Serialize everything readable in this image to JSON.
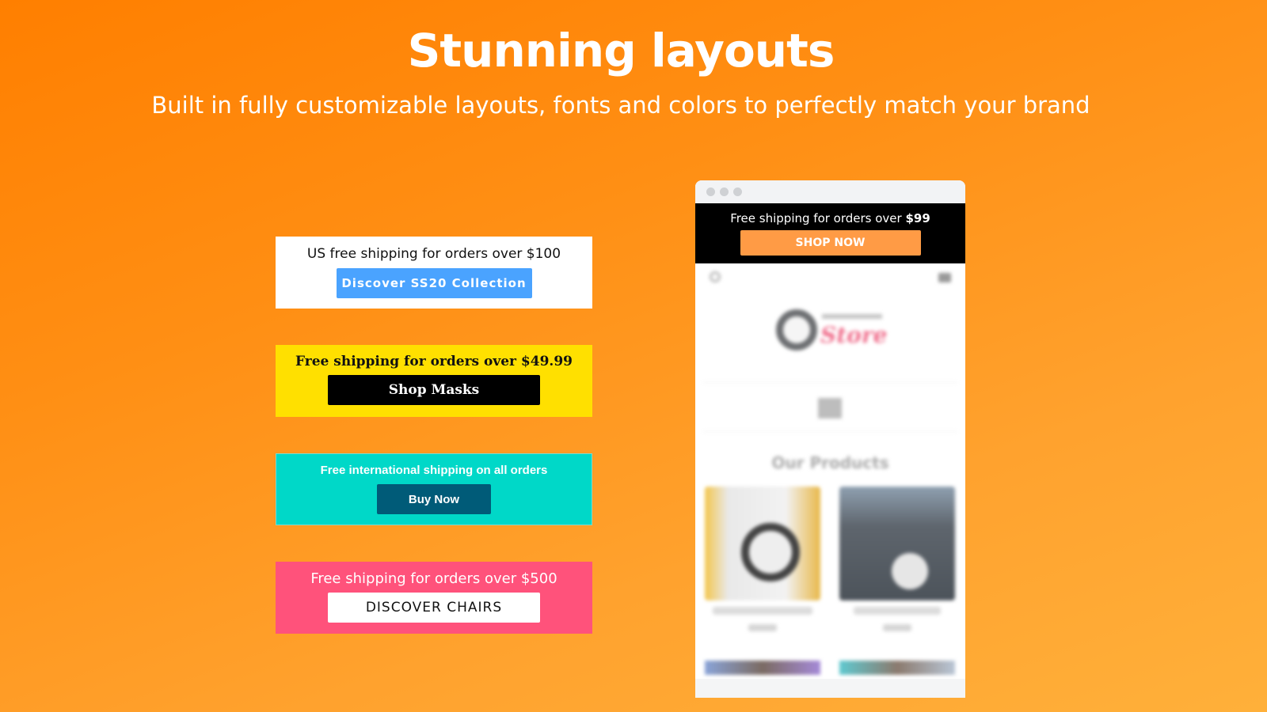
{
  "hero": {
    "title": "Stunning layouts",
    "subtitle": "Built in fully customizable layouts, fonts and colors to perfectly match your brand"
  },
  "banners": [
    {
      "message": "US free shipping for orders over $100",
      "button_label": "Discover SS20 Collection",
      "background": "#ffffff",
      "button_color": "#4aa3ff"
    },
    {
      "message": "Free shipping for orders over $49.99",
      "button_label": "Shop Masks",
      "background": "#ffe000",
      "button_color": "#000000"
    },
    {
      "message": "Free international shipping on all orders",
      "button_label": "Buy Now",
      "background": "#00d8c8",
      "button_color": "#005b78"
    },
    {
      "message": "Free shipping for orders over $500",
      "button_label": "DISCOVER CHAIRS",
      "background": "#ff527b",
      "button_color": "#ffffff"
    }
  ],
  "mockup": {
    "announcement_text": "Free shipping for orders over ",
    "announcement_amount": "$99",
    "button_label": "SHOP NOW",
    "background": "#000000",
    "button_color": "#ff9b45",
    "store": {
      "logo_text": "Store",
      "section_heading": "Our Products"
    }
  },
  "colors": {
    "page_gradient_start": "#ff7f00",
    "page_gradient_end": "#ffb03a"
  }
}
